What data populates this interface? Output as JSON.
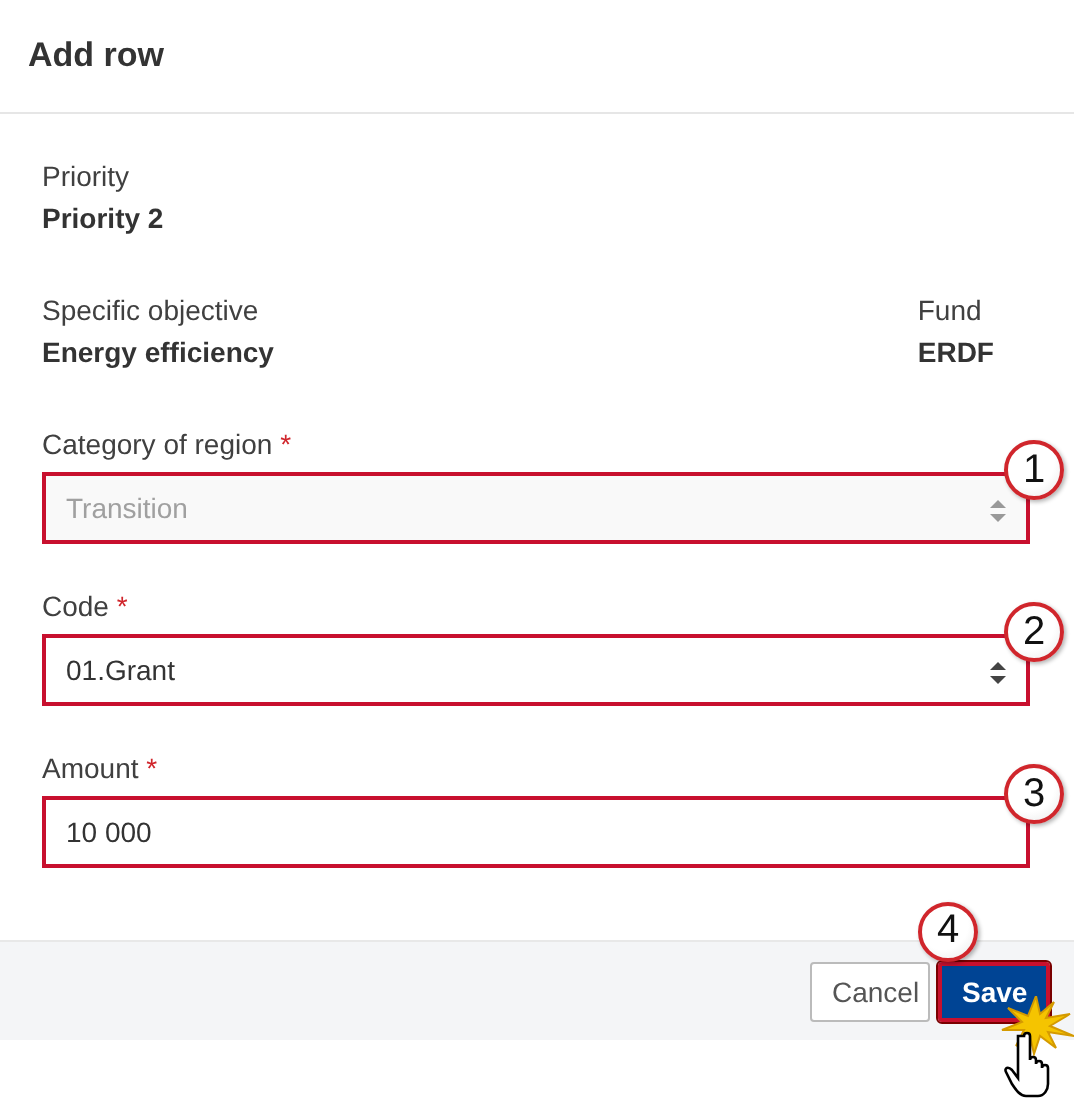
{
  "dialog": {
    "title": "Add row"
  },
  "info_rows": [
    [
      {
        "label": "Priority",
        "value": "Priority 2"
      }
    ],
    [
      {
        "label": "Specific objective",
        "value": "Energy efficiency"
      },
      {
        "label": "Fund",
        "value": "ERDF"
      }
    ]
  ],
  "fields": [
    {
      "label": "Category of region",
      "required_mark": "*",
      "kind": "select",
      "value": "Transition",
      "disabled": true,
      "callout": "1"
    },
    {
      "label": "Code",
      "required_mark": "*",
      "kind": "select",
      "value": "01.Grant",
      "disabled": false,
      "callout": "2"
    },
    {
      "label": "Amount",
      "required_mark": "*",
      "kind": "input",
      "value": "10 000",
      "disabled": false,
      "callout": "3"
    }
  ],
  "buttons": [
    {
      "label": "Cancel",
      "kind": "secondary"
    },
    {
      "label": "Save",
      "kind": "primary",
      "callout": "4"
    }
  ]
}
